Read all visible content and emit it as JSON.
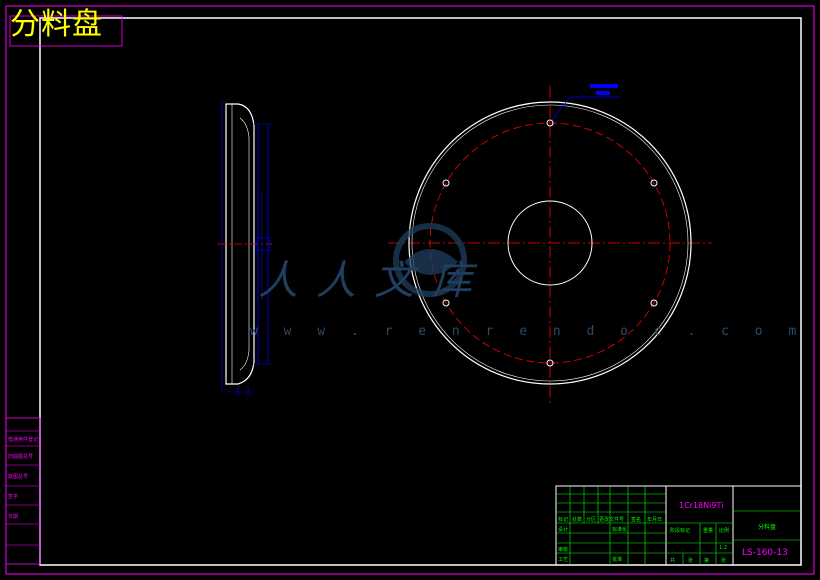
{
  "drawing": {
    "title": "分料盘",
    "material": "1Cr18Ni9Ti",
    "part_name": "分料盘",
    "drawing_number": "LS-160-13",
    "scale": "1:2",
    "watermark_text": "人人文库",
    "watermark_url": "w w w . r e n r e n d o c . c o m"
  },
  "colors": {
    "frame": "#ff00ff",
    "outline": "#ffffff",
    "centerline": "#ff0000",
    "dimension": "#0000ff",
    "title_text": "#ffff00",
    "table_text": "#00ff00"
  },
  "title_block": {
    "headers": [
      "标记",
      "处数",
      "分区",
      "更改文件号",
      "签名",
      "年月日"
    ],
    "row_labels": [
      "设计",
      "审核",
      "工艺"
    ],
    "mid_labels": [
      "阶段标记",
      "重量",
      "比例"
    ],
    "bottom_labels": [
      "共",
      "张",
      "第",
      "张"
    ],
    "standardization": "标准化",
    "approve": "批准"
  },
  "left_strip": {
    "items": [
      "借通用件登记",
      "旧底图总号",
      "底图总号",
      "签字",
      "日期"
    ]
  }
}
